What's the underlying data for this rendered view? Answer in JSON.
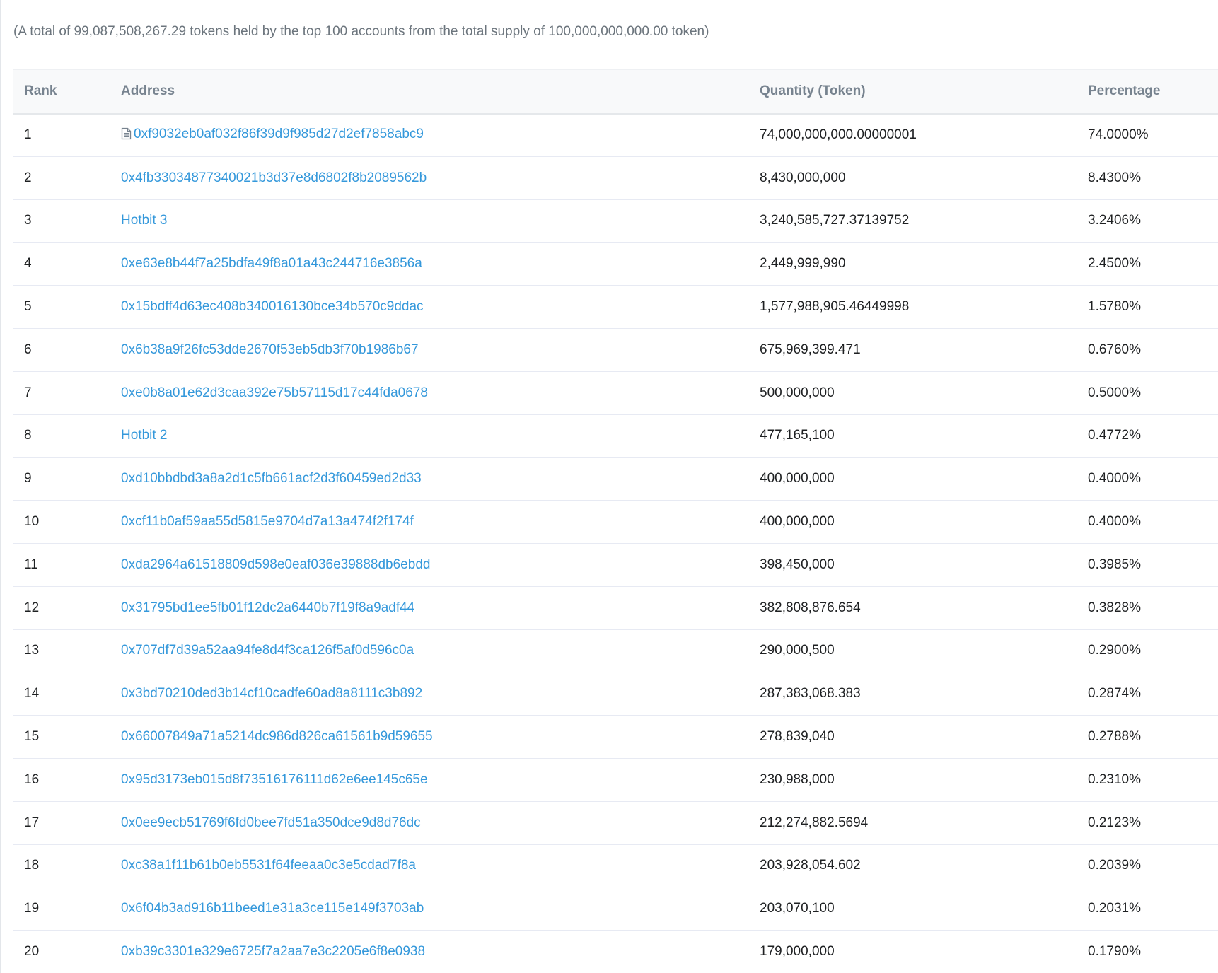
{
  "summary": "(A total of 99,087,508,267.29 tokens held by the top 100 accounts from the total supply of 100,000,000,000.00 token)",
  "table": {
    "headers": {
      "rank": "Rank",
      "address": "Address",
      "quantity": "Quantity (Token)",
      "percentage": "Percentage"
    },
    "rows": [
      {
        "rank": "1",
        "address": "0xf9032eb0af032f86f39d9f985d27d2ef7858abc9",
        "quantity": "74,000,000,000.00000001",
        "percentage": "74.0000%",
        "icon": "contract-document-icon"
      },
      {
        "rank": "2",
        "address": "0x4fb33034877340021b3d37e8d6802f8b2089562b",
        "quantity": "8,430,000,000",
        "percentage": "8.4300%"
      },
      {
        "rank": "3",
        "address": "Hotbit 3",
        "quantity": "3,240,585,727.37139752",
        "percentage": "3.2406%"
      },
      {
        "rank": "4",
        "address": "0xe63e8b44f7a25bdfa49f8a01a43c244716e3856a",
        "quantity": "2,449,999,990",
        "percentage": "2.4500%"
      },
      {
        "rank": "5",
        "address": "0x15bdff4d63ec408b340016130bce34b570c9ddac",
        "quantity": "1,577,988,905.46449998",
        "percentage": "1.5780%"
      },
      {
        "rank": "6",
        "address": "0x6b38a9f26fc53dde2670f53eb5db3f70b1986b67",
        "quantity": "675,969,399.471",
        "percentage": "0.6760%"
      },
      {
        "rank": "7",
        "address": "0xe0b8a01e62d3caa392e75b57115d17c44fda0678",
        "quantity": "500,000,000",
        "percentage": "0.5000%"
      },
      {
        "rank": "8",
        "address": "Hotbit 2",
        "quantity": "477,165,100",
        "percentage": "0.4772%"
      },
      {
        "rank": "9",
        "address": "0xd10bbdbd3a8a2d1c5fb661acf2d3f60459ed2d33",
        "quantity": "400,000,000",
        "percentage": "0.4000%"
      },
      {
        "rank": "10",
        "address": "0xcf11b0af59aa55d5815e9704d7a13a474f2f174f",
        "quantity": "400,000,000",
        "percentage": "0.4000%"
      },
      {
        "rank": "11",
        "address": "0xda2964a61518809d598e0eaf036e39888db6ebdd",
        "quantity": "398,450,000",
        "percentage": "0.3985%"
      },
      {
        "rank": "12",
        "address": "0x31795bd1ee5fb01f12dc2a6440b7f19f8a9adf44",
        "quantity": "382,808,876.654",
        "percentage": "0.3828%"
      },
      {
        "rank": "13",
        "address": "0x707df7d39a52aa94fe8d4f3ca126f5af0d596c0a",
        "quantity": "290,000,500",
        "percentage": "0.2900%"
      },
      {
        "rank": "14",
        "address": "0x3bd70210ded3b14cf10cadfe60ad8a8111c3b892",
        "quantity": "287,383,068.383",
        "percentage": "0.2874%"
      },
      {
        "rank": "15",
        "address": "0x66007849a71a5214dc986d826ca61561b9d59655",
        "quantity": "278,839,040",
        "percentage": "0.2788%"
      },
      {
        "rank": "16",
        "address": "0x95d3173eb015d8f73516176111d62e6ee145c65e",
        "quantity": "230,988,000",
        "percentage": "0.2310%"
      },
      {
        "rank": "17",
        "address": "0x0ee9ecb51769f6fd0bee7fd51a350dce9d8d76dc",
        "quantity": "212,274,882.5694",
        "percentage": "0.2123%"
      },
      {
        "rank": "18",
        "address": "0xc38a1f11b61b0eb5531f64feeaa0c3e5cdad7f8a",
        "quantity": "203,928,054.602",
        "percentage": "0.2039%"
      },
      {
        "rank": "19",
        "address": "0x6f04b3ad916b11beed1e31a3ce115e149f3703ab",
        "quantity": "203,070,100",
        "percentage": "0.2031%"
      },
      {
        "rank": "20",
        "address": "0xb39c3301e329e6725f7a2aa7e3c2205e6f8e0938",
        "quantity": "179,000,000",
        "percentage": "0.1790%"
      }
    ]
  },
  "colors": {
    "link": "#3498db",
    "text": "#1e2022",
    "muted": "#6c757d",
    "header_bg": "#f8f9fa",
    "border": "#e7eaf3"
  }
}
